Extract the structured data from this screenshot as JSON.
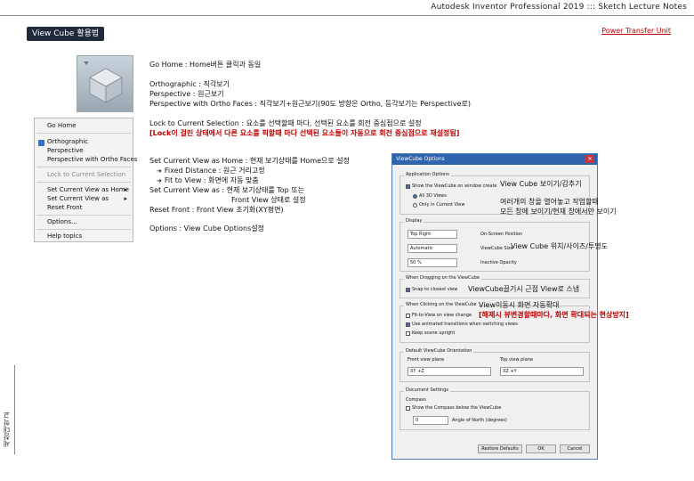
{
  "header": {
    "title": "Autodesk Inventor Professional 2019 ::: Sketch Lecture Notes"
  },
  "section": {
    "title": "View Cube 활용법",
    "unit_link": "Power Transfer Unit"
  },
  "side_label": "세창대학교",
  "context_menu": {
    "items": [
      "Go Home",
      "Orthographic",
      "Perspective",
      "Perspective with Ortho Faces",
      "Lock to Current Selection",
      "Set Current View as Home",
      "Set Current View as",
      "Reset Front",
      "Options...",
      "Help topics"
    ],
    "submenu_arrow": "▸"
  },
  "descriptions": {
    "go_home": "Go Home : Home버튼 클릭과 동일",
    "ortho": "Orthographic : 직각보기",
    "persp": "Perspective : 원근보기",
    "persp_ortho": "Perspective with Ortho Faces : 직각보기+원근보기(90도 방향은 Ortho, 등각보기는 Perspective로)",
    "lock": "Lock to Current Selection : 요소를 선택할때 마다, 선택된 요소를 회전 중심점으로 설정",
    "lock_note": "[Lock이 걸린 상태에서 다른 요소를 픽할때 마다 선택된 요소들이 자동으로 회전 중심점으로 재설정됨]",
    "set_home": "Set Current View as Home : 현재 보기상태를 Home으로 설정",
    "fixed_distance": "Fixed Distance : 원근 거리고정",
    "fit_view": "Fit to View : 화면에 자동 맞춤",
    "set_as": "Set Current View as : 현재 보기상태를 Top 또는",
    "set_as_2": "Front View 상태로 설정",
    "reset_front": "Reset Front : Front View 초기화(XY평면)",
    "options": "Options : View Cube Options설정",
    "arrow": "➔"
  },
  "dialog": {
    "title": "ViewCube Options",
    "close": "✕",
    "app_options": "Application Options",
    "show_cube": "Show the ViewCube on window create",
    "all_views": "All 3D Views",
    "only_current": "Only in Current View",
    "display": "Display",
    "position_value": "Top Right",
    "position_label": "On-Screen Position",
    "size_value": "Automatic",
    "size_label": "ViewCube Size",
    "opacity_value": "50 %",
    "opacity_label": "Inactive Opacity",
    "when_dragging": "When Dragging on the ViewCube",
    "snap": "Snap to closest view",
    "when_clicking": "When Clicking on the ViewCube",
    "fit_on_change": "Fit-to-View on view change",
    "animated": "Use animated transitions when switching views",
    "keep_upright": "Keep scene upright",
    "default_orient": "Default ViewCube Orientation",
    "front_view_label": "Front view plane",
    "top_view_label": "Top view plane",
    "front_view_value": "XY +Z",
    "top_view_value": "XZ +Y",
    "doc_settings": "Document Settings",
    "compass": "Compass",
    "show_compass": "Show the Compass below the ViewCube",
    "angle_label": "Angle of North (degrees)",
    "angle_value": "0",
    "restore": "Restore Defaults",
    "ok": "OK",
    "cancel": "Cancel"
  },
  "annotations": {
    "show_hide": "View Cube 보이기/감추기",
    "multi_view_1": "여러개의 창을 열어놓고 작업할때",
    "multi_view_2": "모든 창에 보이기/현재 창에서만 보이기",
    "position_size": "View Cube 위치/사이즈/투명도",
    "snap_note": "ViewCube끌기시 근접 View로 스냅",
    "fit_note": "View이동시 화면 자동확대",
    "fit_note_red": "[해제시 뷰변경할때마다, 화면 확대되는 현상방지]"
  }
}
